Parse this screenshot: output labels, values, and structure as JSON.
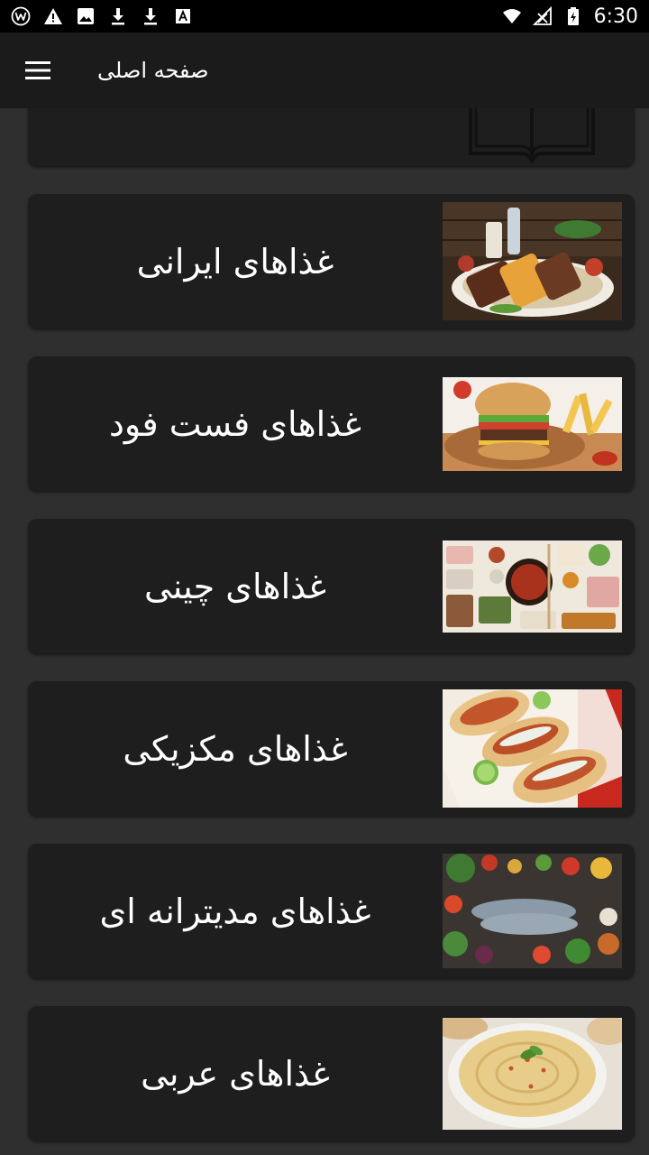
{
  "status_bar": {
    "time": "6:30",
    "icons": [
      "w-app-icon",
      "warning-icon",
      "image-icon",
      "download-icon",
      "download-icon",
      "font-a-icon",
      "wifi-icon",
      "signal-icon",
      "battery-charging-icon"
    ]
  },
  "app_bar": {
    "title": "صفحه اصلی",
    "menu_icon": "hamburger-menu-icon"
  },
  "colors": {
    "background": "#2f2f2f",
    "card": "#1f1e1f",
    "app_bar": "#1b1b1b",
    "status_bar": "#000000",
    "text": "#ffffff"
  },
  "categories": [
    {
      "id": "recipes-book",
      "label": "",
      "thumb": "book-icon"
    },
    {
      "id": "iranian",
      "label": "غذاهای  ایرانی",
      "thumb": "iranian-food-photo"
    },
    {
      "id": "fast-food",
      "label": "غذاهای فست فود",
      "thumb": "burger-photo"
    },
    {
      "id": "chinese",
      "label": "غذاهای چینی",
      "thumb": "chinese-food-photo"
    },
    {
      "id": "mexican",
      "label": "غذاهای مکزیکی",
      "thumb": "tacos-photo"
    },
    {
      "id": "mediterranean",
      "label": "غذاهای مدیترانه ای",
      "thumb": "mediterranean-food-photo"
    },
    {
      "id": "arabic",
      "label": "غذاهای عربی",
      "thumb": "hummus-photo"
    }
  ]
}
